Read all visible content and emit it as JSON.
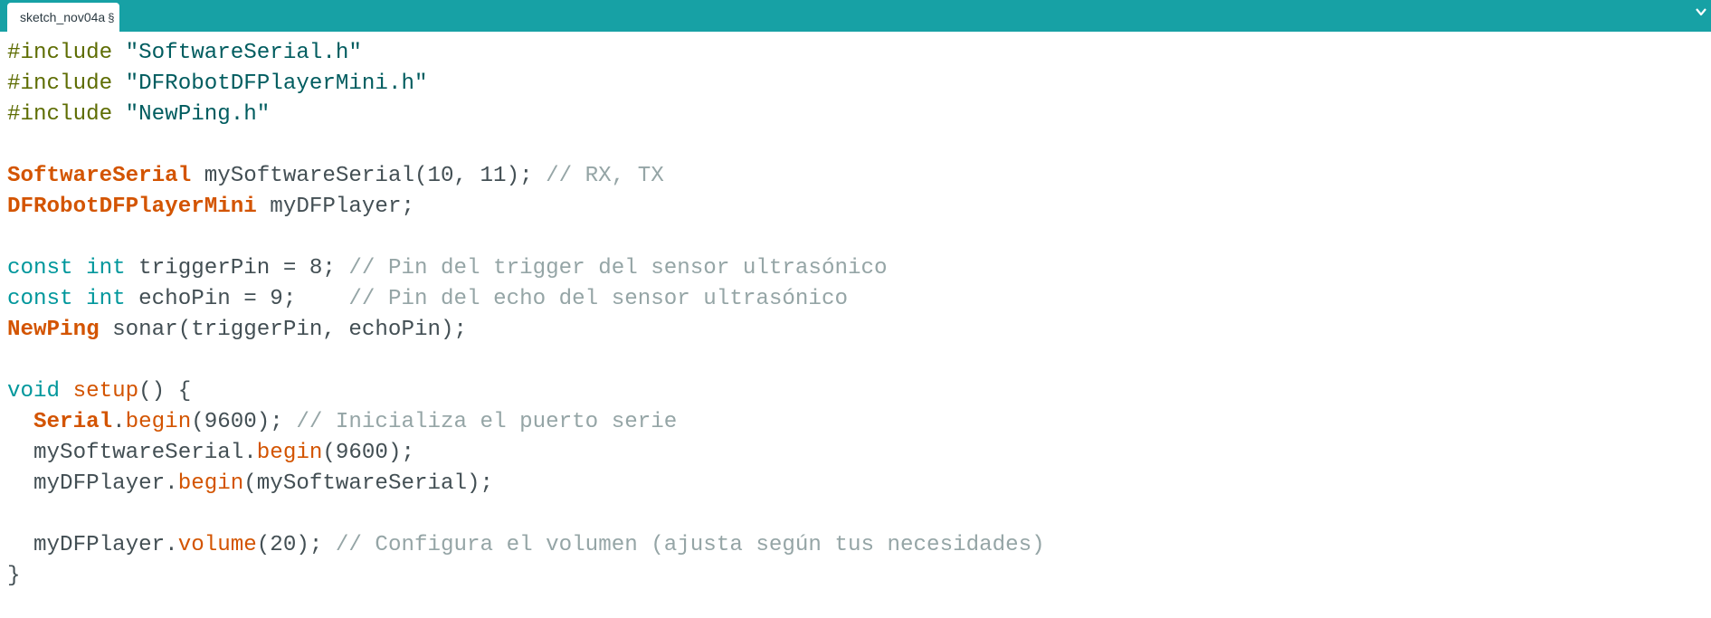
{
  "tab": {
    "name": "sketch_nov04a",
    "modified_marker": "§"
  },
  "icons": {
    "tab_menu": "chevron-down-icon"
  },
  "colors": {
    "tab_bar": "#17a1a5",
    "preprocessor": "#5e6d03",
    "string": "#005c5f",
    "type": "#d35400",
    "keyword": "#00979c",
    "function": "#d35400",
    "comment": "#95a5a6",
    "text": "#434f54"
  },
  "code_lines": [
    [
      {
        "k": "pp",
        "t": "#include"
      },
      {
        "k": "tx",
        "t": " "
      },
      {
        "k": "str",
        "t": "\"SoftwareSerial.h\""
      }
    ],
    [
      {
        "k": "pp",
        "t": "#include"
      },
      {
        "k": "tx",
        "t": " "
      },
      {
        "k": "str",
        "t": "\"DFRobotDFPlayerMini.h\""
      }
    ],
    [
      {
        "k": "pp",
        "t": "#include"
      },
      {
        "k": "tx",
        "t": " "
      },
      {
        "k": "str",
        "t": "\"NewPing.h\""
      }
    ],
    [],
    [
      {
        "k": "type",
        "t": "SoftwareSerial"
      },
      {
        "k": "tx",
        "t": " mySoftwareSerial(10, 11); "
      },
      {
        "k": "cm",
        "t": "// RX, TX"
      }
    ],
    [
      {
        "k": "type",
        "t": "DFRobotDFPlayerMini"
      },
      {
        "k": "tx",
        "t": " myDFPlayer;"
      }
    ],
    [],
    [
      {
        "k": "kw",
        "t": "const"
      },
      {
        "k": "tx",
        "t": " "
      },
      {
        "k": "kw",
        "t": "int"
      },
      {
        "k": "tx",
        "t": " triggerPin = 8; "
      },
      {
        "k": "cm",
        "t": "// Pin del trigger del sensor ultrasónico"
      }
    ],
    [
      {
        "k": "kw",
        "t": "const"
      },
      {
        "k": "tx",
        "t": " "
      },
      {
        "k": "kw",
        "t": "int"
      },
      {
        "k": "tx",
        "t": " echoPin = 9;    "
      },
      {
        "k": "cm",
        "t": "// Pin del echo del sensor ultrasónico"
      }
    ],
    [
      {
        "k": "type",
        "t": "NewPing"
      },
      {
        "k": "tx",
        "t": " sonar(triggerPin, echoPin);"
      }
    ],
    [],
    [
      {
        "k": "kw",
        "t": "void"
      },
      {
        "k": "tx",
        "t": " "
      },
      {
        "k": "fn",
        "t": "setup"
      },
      {
        "k": "tx",
        "t": "() {"
      }
    ],
    [
      {
        "k": "tx",
        "t": "  "
      },
      {
        "k": "type",
        "t": "Serial"
      },
      {
        "k": "tx",
        "t": "."
      },
      {
        "k": "fn",
        "t": "begin"
      },
      {
        "k": "tx",
        "t": "(9600); "
      },
      {
        "k": "cm",
        "t": "// Inicializa el puerto serie"
      }
    ],
    [
      {
        "k": "tx",
        "t": "  mySoftwareSerial."
      },
      {
        "k": "fn",
        "t": "begin"
      },
      {
        "k": "tx",
        "t": "(9600);"
      }
    ],
    [
      {
        "k": "tx",
        "t": "  myDFPlayer."
      },
      {
        "k": "fn",
        "t": "begin"
      },
      {
        "k": "tx",
        "t": "(mySoftwareSerial);"
      }
    ],
    [],
    [
      {
        "k": "tx",
        "t": "  myDFPlayer."
      },
      {
        "k": "fn",
        "t": "volume"
      },
      {
        "k": "tx",
        "t": "(20); "
      },
      {
        "k": "cm",
        "t": "// Configura el volumen (ajusta según tus necesidades)"
      }
    ],
    [
      {
        "k": "tx",
        "t": "}"
      }
    ]
  ]
}
